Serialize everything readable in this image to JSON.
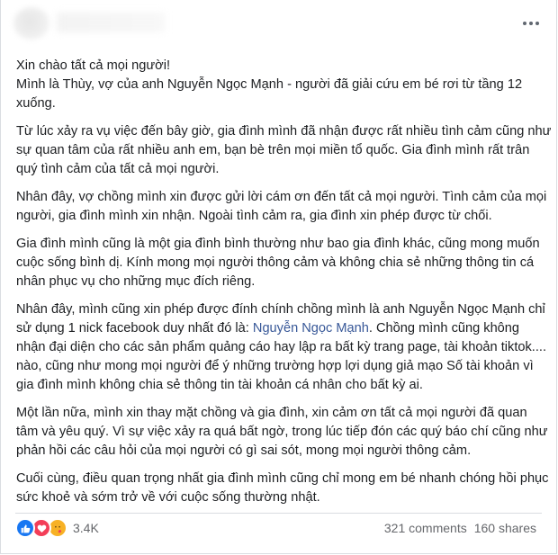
{
  "post": {
    "paragraphs": [
      [
        "Xin chào tất cả mọi người!",
        "Mình là Thùy, vợ của anh Nguyễn Ngọc Mạnh - người đã giải cứu em bé rơi từ tầng 12 xuống."
      ],
      [
        "Từ lúc xảy ra vụ việc đến bây giờ, gia đình mình đã nhận được rất nhiều tình cảm cũng như sự quan tâm của rất nhiều anh em, bạn bè trên mọi miền tổ quốc. Gia đình mình rất trân quý tình cảm của tất cả mọi người."
      ],
      [
        "Nhân đây, vợ chồng mình xin được gửi lời cám ơn đến tất cả mọi người. Tình cảm của mọi người, gia đình mình xin nhận. Ngoài tình cảm ra, gia đình xin phép được từ chối."
      ],
      [
        "Gia đình mình cũng là một gia đình bình thường như bao gia đình khác, cũng mong muốn cuộc sống bình dị. Kính mong mọi người thông cảm và không chia sẻ những thông tin cá nhân phục vụ cho những mục đích riêng."
      ]
    ],
    "correction": {
      "before": "Nhân đây, mình cũng xin phép được đính chính chồng mình là anh Nguyễn Ngọc Mạnh chỉ sử dụng 1 nick facebook duy nhất đó là: ",
      "link": "Nguyễn Ngọc Mạnh",
      "after": ". Chồng mình cũng không nhận đại diện cho các sản phẩm quảng cáo hay lập ra bất kỳ trang page, tài khoản tiktok.... nào, cũng như mong mọi người để ý những trường hợp lợi dụng giả mạo Số tài khoản vì gia đình mình không chia sẻ thông tin tài khoản cá nhân cho bất kỳ ai."
    },
    "closing": [
      "Một lần nữa, mình xin thay mặt chồng và gia đình, xin cảm ơn tất cả mọi người đã quan tâm và yêu quý. Vì sự việc xảy ra quá bất ngờ, trong lúc tiếp đón các quý báo chí cũng như phản hồi các câu hỏi của mọi người có gì sai sót, mong mọi người thông cảm.",
      "Cuối cùng, điều quan trọng nhất gia đình mình cũng chỉ mong em bé nhanh chóng hồi phục sức khoẻ và sớm trở về với cuộc sống thường nhật."
    ]
  },
  "footer": {
    "reactions": [
      "like-icon",
      "love-icon",
      "care-icon"
    ],
    "reaction_count": "3.4K",
    "comments": "321 comments",
    "shares": "160 shares"
  },
  "colors": {
    "link": "#385898",
    "like": "#1877f2",
    "love": "#f33e58",
    "care": "#f7b125",
    "muted": "#65676b"
  }
}
